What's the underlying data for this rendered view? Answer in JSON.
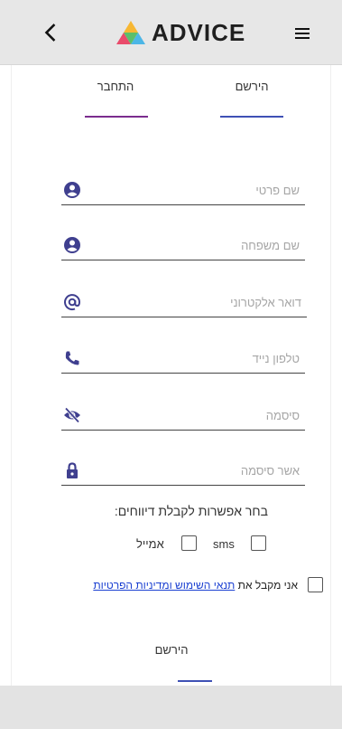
{
  "header": {
    "logo_text": "ADVICE",
    "back_icon": "chevron-left-icon",
    "menu_icon": "hamburger-menu-icon"
  },
  "tabs": {
    "register": "הירשם",
    "login": "התחבר"
  },
  "form": {
    "first_name_placeholder": "שם פרטי",
    "last_name_placeholder": "שם משפחה",
    "email_placeholder": "דואר אלקטרוני",
    "phone_placeholder": "טלפון נייד",
    "password_placeholder": "סיסמה",
    "confirm_password_placeholder": "אשר סיסמה"
  },
  "reports": {
    "title": "בחר אפשרות לקבלת דיווחים:",
    "sms_label": "sms",
    "email_label": "אמייל"
  },
  "terms": {
    "prefix": "אני מקבל את",
    "link": "תנאי השימוש ומדיניות הפרטיות"
  },
  "submit_label": "הירשם",
  "colors": {
    "accent_blue": "#3f51b5",
    "accent_purple": "#7b2d8e",
    "icon_color": "#3f3f8f",
    "link_color": "#1a3fd1"
  }
}
